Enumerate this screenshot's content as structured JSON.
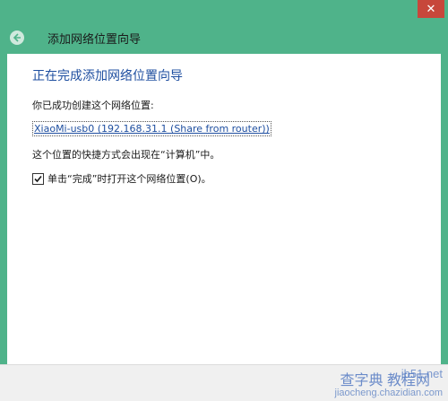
{
  "window": {
    "close_glyph": "✕"
  },
  "header": {
    "title": "添加网络位置向导",
    "back_icon": "back-arrow-icon"
  },
  "content": {
    "heading": "正在完成添加网络位置向导",
    "created_text": "你已成功创建这个网络位置:",
    "location_link": "XiaoMi-usb0 (192.168.31.1 (Share from router))",
    "shortcut_text": "这个位置的快捷方式会出现在“计算机”中。",
    "checkbox_label": "单击“完成”时打开这个网络位置(O)。",
    "checkbox_checked": true
  },
  "watermark": {
    "site": "jb51.net",
    "big": "查字典 教程网",
    "url": "jiaocheng.chazidian.com"
  },
  "colors": {
    "window_frame": "#4fb38a",
    "close_button": "#c7473b",
    "heading": "#1f4fa0",
    "footer": "#f0f0f0"
  }
}
